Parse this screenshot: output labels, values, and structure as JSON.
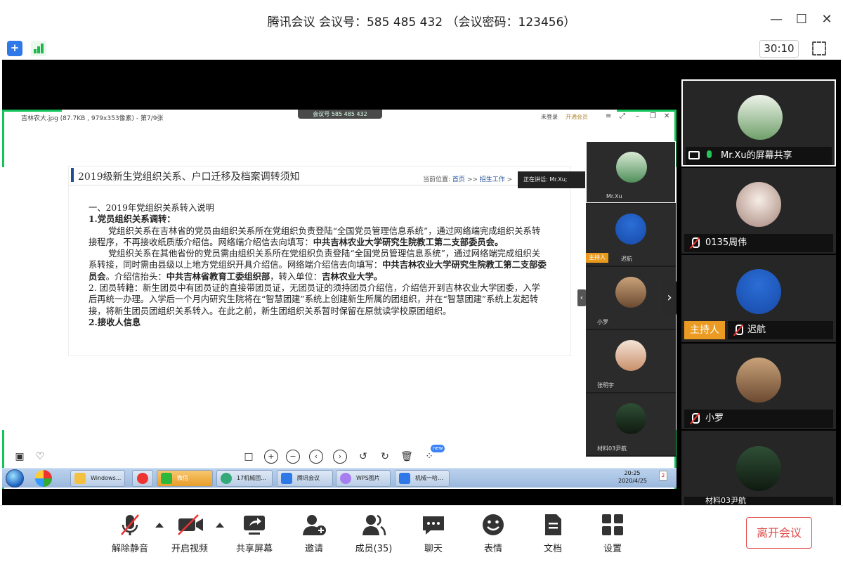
{
  "window": {
    "title": "腾讯会议 会议号：585 485 432 （会议密码：123456）",
    "minimize": "—",
    "maximize": "☐",
    "close": "✕"
  },
  "status": {
    "timer": "30:10"
  },
  "shared_screen": {
    "image_title": "吉林农大.jpg (87.7KB , 979x353像素) - 第7/9张",
    "meeting_pill": "会议号 585 485 432",
    "login": "未登录",
    "vip": "开通会员",
    "lecturer": "正在讲话: Mr.Xu;",
    "doc": {
      "title": "2019级新生党组织关系、户口迁移及档案调转须知",
      "crumb_prefix": "当前位置:",
      "crumb_home": "首页",
      "crumb_sep": ">>",
      "crumb_section": "招生工作",
      "crumb_sep2": ">",
      "p1": "一、2019年党组织关系转入说明",
      "p2": "1.党员组织关系调转：",
      "p3a": "党组织关系在吉林省的党员由组织关系所在党组织负责登陆“全国党员管理信息系统”，通过网络端完成组织关系转接程序，不再接收纸质版介绍信。网络端介绍信去向填写：",
      "p3b": "中共吉林农业大学研究生院教工第二支部委员会。",
      "p4a": "党组织关系在其他省份的党员需由组织关系所在党组织负责登陆“全国党员管理信息系统”，通过网络端完成组织关系转接，同时需由县级以上地方党组织开具介绍信。网络端介绍信去向填写：",
      "p4b": "中共吉林农业大学研究生院教工第二支部委员会",
      "p4c": "。介绍信抬头：",
      "p4d": "中共吉林省教育工委组织部",
      "p4e": "，转入单位：",
      "p4f": "吉林农业大学。",
      "p5": "2. 团员转籍：新生团员中有团员证的直接带团员证，无团员证的须持团员介绍信，介绍信开到吉林农业大学团委，入学后再统一办理。入学后一个月内研究生院将在“智慧团建”系统上创建新生所属的团组织，并在“智慧团建”系统上发起转接，将新生团员团组织关系转入。在此之前，新生团组织关系暂时保留在原就读学校原团组织。",
      "p6": "2.接收人信息"
    },
    "inner_tiles": [
      {
        "name": "Mr.Xu"
      },
      {
        "name": "迟航",
        "host": "主持人"
      },
      {
        "name": "小罗"
      },
      {
        "name": "张明宇"
      },
      {
        "name": "材料03尹航"
      }
    ],
    "taskbar": {
      "items": [
        "Windows...",
        "",
        "微信",
        "17机械团...",
        "腾讯会议",
        "WPS图片",
        "机械一哈..."
      ],
      "time": "20:25",
      "date": "2020/4/25",
      "badge": "2"
    },
    "viewer_new": "new"
  },
  "participants": [
    {
      "name": "Mr.Xu的屏幕共享",
      "selected": true
    },
    {
      "name": "0135周伟"
    },
    {
      "name": "迟航",
      "host": "主持人"
    },
    {
      "name": "小罗"
    },
    {
      "name": "材料03尹航"
    }
  ],
  "toolbar": {
    "unmute": "解除静音",
    "video": "开启视频",
    "share": "共享屏幕",
    "invite": "邀请",
    "members": "成员(35)",
    "chat": "聊天",
    "emoji": "表情",
    "docs": "文档",
    "settings": "设置",
    "leave": "离开会议"
  },
  "colors": {
    "green": "#14c35a",
    "host_orange": "#eb9b22",
    "leave_red": "#e24a4a",
    "blue": "#2f78e8"
  }
}
